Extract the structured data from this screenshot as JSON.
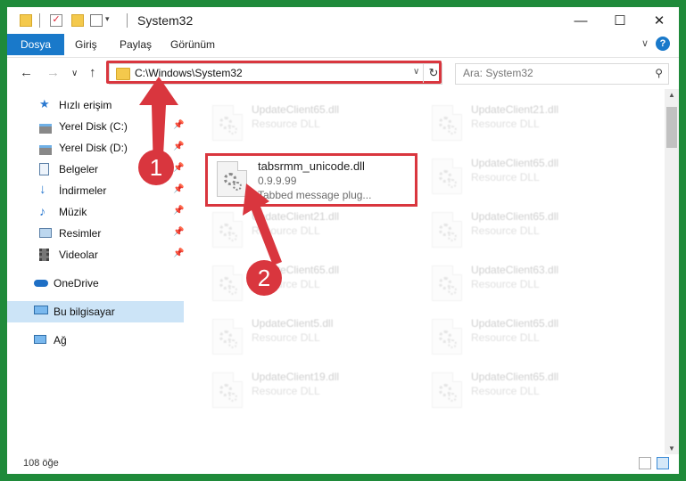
{
  "window": {
    "title": "System32",
    "controls": {
      "minimize": "—",
      "maximize": "☐",
      "close": "✕"
    }
  },
  "ribbon": {
    "tabs": [
      "Dosya",
      "Giriş",
      "Paylaş",
      "Görünüm"
    ],
    "help": "?"
  },
  "address": {
    "path": "C:\\Windows\\System32",
    "refresh": "↻",
    "dropdown": "∨"
  },
  "search": {
    "placeholder": "Ara: System32",
    "icon": "search-icon"
  },
  "nav": {
    "back": "←",
    "forward": "→",
    "recent": "∨",
    "up": "↑"
  },
  "sidebar": {
    "items": [
      {
        "label": "Hızlı erişim",
        "icon": "star-icon",
        "pinned": false
      },
      {
        "label": "Yerel Disk (C:)",
        "icon": "drive-icon",
        "pinned": true
      },
      {
        "label": "Yerel Disk (D:)",
        "icon": "drive-icon",
        "pinned": true
      },
      {
        "label": "Belgeler",
        "icon": "documents-icon",
        "pinned": true
      },
      {
        "label": "İndirmeler",
        "icon": "download-icon",
        "pinned": true
      },
      {
        "label": "Müzik",
        "icon": "music-icon",
        "pinned": true
      },
      {
        "label": "Resimler",
        "icon": "pictures-icon",
        "pinned": true
      },
      {
        "label": "Videolar",
        "icon": "videos-icon",
        "pinned": true
      },
      {
        "label": "OneDrive",
        "icon": "cloud-icon",
        "pinned": false
      },
      {
        "label": "Bu bilgisayar",
        "icon": "computer-icon",
        "pinned": false
      },
      {
        "label": "Ağ",
        "icon": "network-icon",
        "pinned": false
      }
    ],
    "pin_glyph": "📌"
  },
  "files": {
    "left": [
      {
        "name": "UpdateClient65.dll",
        "type": "Resource DLL"
      },
      {
        "name": "UpdateClient21.dll",
        "type": "Resource DLL"
      },
      {
        "name": "UpdateClient65.dll",
        "type": "Resource DLL"
      },
      {
        "name": "UpdateClient5.dll",
        "type": "Resource DLL"
      },
      {
        "name": "UpdateClient19.dll",
        "type": "Resource DLL"
      }
    ],
    "right": [
      {
        "name": "UpdateClient21.dll",
        "type": "Resource DLL"
      },
      {
        "name": "UpdateClient65.dll",
        "type": "Resource DLL"
      },
      {
        "name": "UpdateClient65.dll",
        "type": "Resource DLL"
      },
      {
        "name": "UpdateClient63.dll",
        "type": "Resource DLL"
      },
      {
        "name": "UpdateClient65.dll",
        "type": "Resource DLL"
      },
      {
        "name": "UpdateClient65.dll",
        "type": "Resource DLL"
      }
    ],
    "selected": {
      "name": "tabsrmm_unicode.dll",
      "version": "0.9.9.99",
      "description": "Tabbed message plug..."
    }
  },
  "annotations": {
    "step1": "1",
    "step2": "2",
    "color": "#d9363e"
  },
  "status": {
    "count": "108 öğe"
  }
}
